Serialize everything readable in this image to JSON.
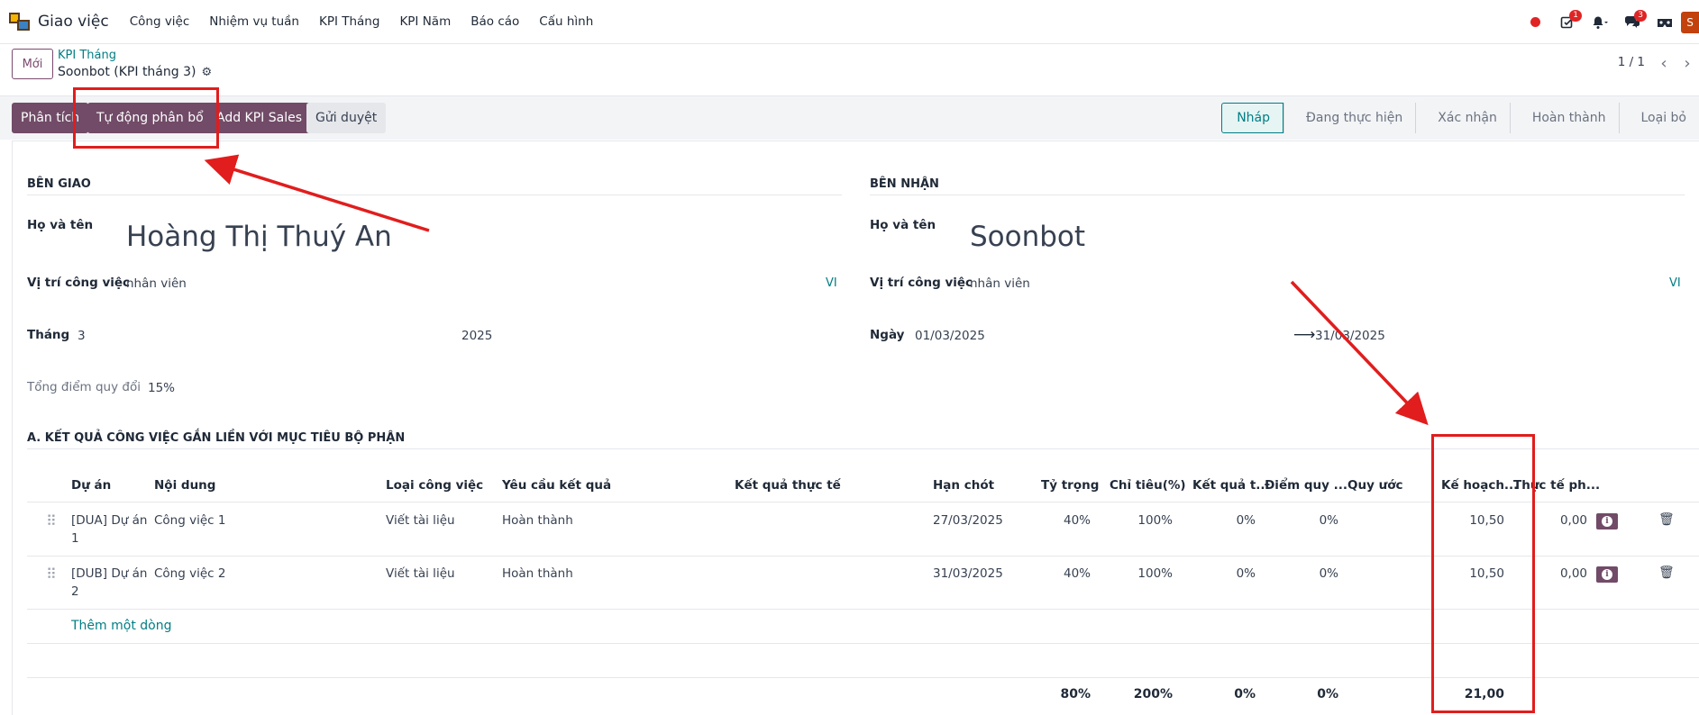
{
  "navbar": {
    "app_name": "Giao việc",
    "menu": [
      "Công việc",
      "Nhiệm vụ tuần",
      "KPI Tháng",
      "KPI Năm",
      "Báo cáo",
      "Cấu hình"
    ],
    "activity_badge": "1",
    "messages_badge": "3",
    "avatar_letter": "S"
  },
  "control": {
    "new_label": "Mới",
    "breadcrumb": "KPI Tháng",
    "record_title": "Soonbot (KPI tháng 3)",
    "pager": "1 / 1"
  },
  "actions": {
    "analyze": "Phân tích",
    "auto_allocate": "Tự động phân bổ",
    "add_kpi_sales": "Add KPI Sales",
    "submit": "Gửi duyệt"
  },
  "statusbar": [
    "Nháp",
    "Đang thực hiện",
    "Xác nhận",
    "Hoàn thành",
    "Loại bỏ"
  ],
  "assigner": {
    "section": "BÊN GIAO",
    "name_label": "Họ và tên",
    "name": "Hoàng Thị Thuý An",
    "position_label": "Vị trí công việc",
    "position": "nhân viên",
    "lang": "VI",
    "month_label": "Tháng",
    "month": "3",
    "year": "2025",
    "score_label": "Tổng điểm quy đổi",
    "score": "15%"
  },
  "receiver": {
    "section": "BÊN NHẬN",
    "name_label": "Họ và tên",
    "name": "Soonbot",
    "position_label": "Vị trí công việc",
    "position": "nhân viên",
    "lang": "VI",
    "date_label": "Ngày",
    "date_from": "01/03/2025",
    "date_to": "31/03/2025"
  },
  "section_a": "A. KẾT QUẢ CÔNG VIỆC GẮN LIỀN VỚI MỤC TIÊU BỘ PHẬN",
  "table": {
    "headers": [
      "Dự án",
      "Nội dung",
      "Loại công việc",
      "Yêu cầu kết quả",
      "Kết quả thực tế",
      "Hạn chót",
      "Tỷ trọng",
      "Chỉ tiêu(%)",
      "Kết quả t...",
      "Điểm quy ...",
      "Quy ước",
      "Kế hoạch...",
      "Thực tế ph..."
    ],
    "rows": [
      {
        "project_1": "[DUA] Dự án",
        "project_2": "1",
        "content": "Công việc 1",
        "type": "Viết tài liệu",
        "requirement": "Hoàn thành",
        "deadline": "27/03/2025",
        "weight": "40%",
        "target": "100%",
        "result": "0%",
        "score": "0%",
        "plan": "10,50",
        "actual": "0,00"
      },
      {
        "project_1": "[DUB] Dự án",
        "project_2": "2",
        "content": "Công việc 2",
        "type": "Viết tài liệu",
        "requirement": "Hoàn thành",
        "deadline": "31/03/2025",
        "weight": "40%",
        "target": "100%",
        "result": "0%",
        "score": "0%",
        "plan": "10,50",
        "actual": "0,00"
      }
    ],
    "add_line": "Thêm một dòng",
    "totals": {
      "weight": "80%",
      "target": "200%",
      "result": "0%",
      "score": "0%",
      "plan": "21,00"
    }
  },
  "colors": {
    "primary": "#714b67",
    "accent": "#017e84",
    "annotation": "#e11d1d"
  }
}
